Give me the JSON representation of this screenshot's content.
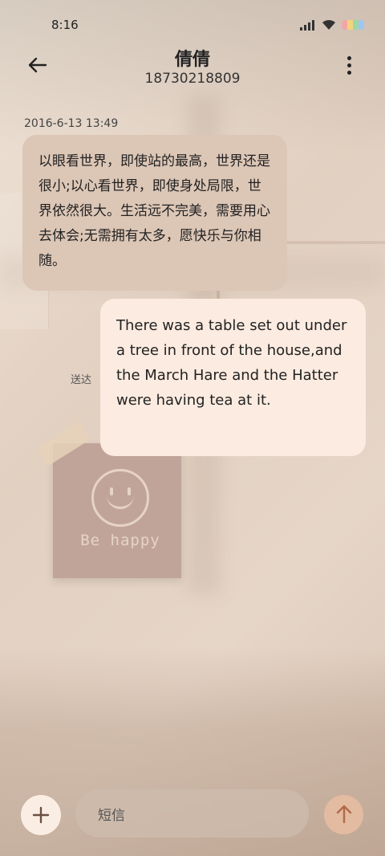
{
  "status_bar": {
    "time": "8:16",
    "icons": [
      "signal-icon",
      "wifi-icon",
      "battery-icon"
    ],
    "battery_colors": [
      "#f2a7a7",
      "#f5d27d",
      "#9fd6a6",
      "#9ec6f0"
    ]
  },
  "header": {
    "back_icon": "back-arrow-icon",
    "contact_name": "倩倩",
    "contact_number": "18730218809",
    "more_icon": "more-vertical-icon"
  },
  "messages": [
    {
      "direction": "incoming",
      "timestamp": "2016-6-13 13:49",
      "text": "以眼看世界，即使站的最高，世界还是很小;以心看世界，即使身处局限，世界依然很大。生活远不完美，需要用心去体会;无需拥有太多，愿快乐与你相随。"
    },
    {
      "direction": "outgoing",
      "text": "There was a table set out under a tree in front of the house,and the March Hare and the Hatter were having tea at it.",
      "status": "送达"
    }
  ],
  "decoration": {
    "sticky_note_text": "Be happy"
  },
  "input_bar": {
    "add_icon": "plus-icon",
    "placeholder": "短信",
    "send_icon": "arrow-up-icon"
  },
  "colors": {
    "incoming_bubble": "#dcc6b6",
    "outgoing_bubble": "#fcebe0",
    "send_button": "#e3bba1"
  }
}
